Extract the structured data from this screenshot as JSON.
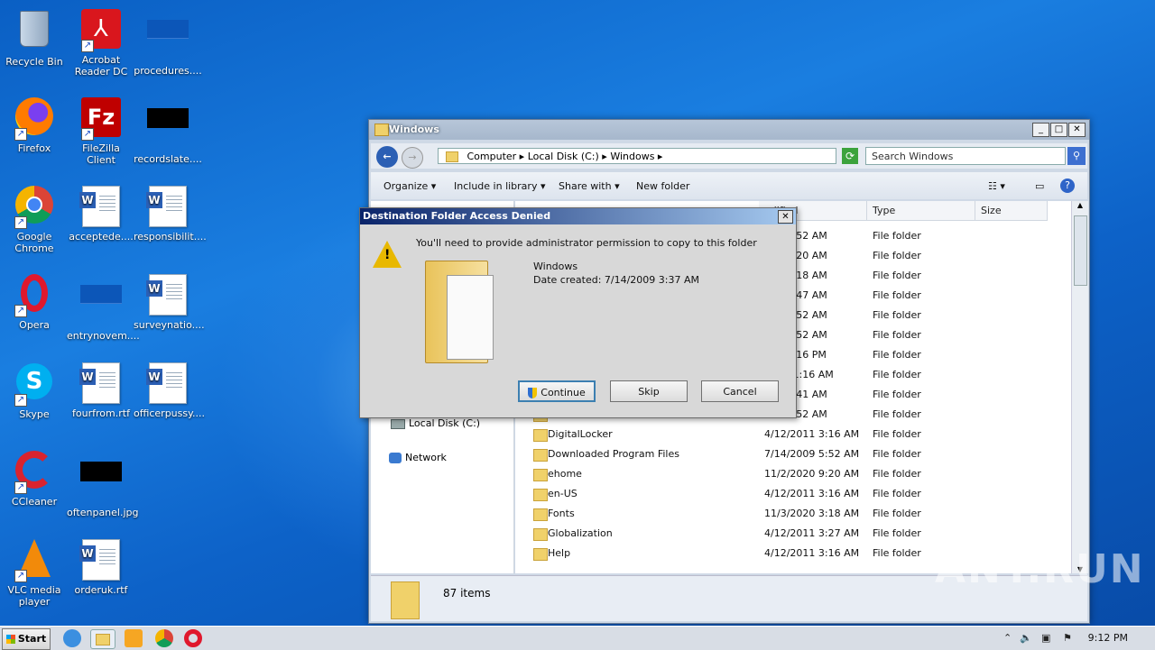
{
  "desktop": {
    "icons": [
      {
        "label": "Recycle Bin"
      },
      {
        "label": "Acrobat Reader DC"
      },
      {
        "label": "procedures...."
      },
      {
        "label": "Firefox"
      },
      {
        "label": "FileZilla Client"
      },
      {
        "label": "recordslate...."
      },
      {
        "label": "Google Chrome"
      },
      {
        "label": "acceptede...."
      },
      {
        "label": "responsibilit...."
      },
      {
        "label": "Opera"
      },
      {
        "label": "entrynovem...."
      },
      {
        "label": "surveynatio...."
      },
      {
        "label": "Skype"
      },
      {
        "label": "fourfrom.rtf"
      },
      {
        "label": "officerpussy...."
      },
      {
        "label": "CCleaner"
      },
      {
        "label": "oftenpanel.jpg"
      },
      {
        "label": "VLC media player"
      },
      {
        "label": "orderuk.rtf"
      }
    ]
  },
  "explorer": {
    "title": "Windows",
    "breadcrumb": [
      "Computer",
      "Local Disk (C:)",
      "Windows"
    ],
    "search_placeholder": "Search Windows",
    "toolbar": {
      "organize": "Organize",
      "include": "Include in library",
      "share": "Share with",
      "new_folder": "New folder"
    },
    "columns": {
      "modified": "odified",
      "type": "Type",
      "size": "Size"
    },
    "rows": [
      {
        "name": "",
        "date": "009 5:52 AM",
        "type": "File folder"
      },
      {
        "name": "",
        "date": "020 9:20 AM",
        "type": "File folder"
      },
      {
        "name": "",
        "date": "020 3:18 AM",
        "type": "File folder"
      },
      {
        "name": "",
        "date": "020 7:47 AM",
        "type": "File folder"
      },
      {
        "name": "",
        "date": "009 5:52 AM",
        "type": "File folder"
      },
      {
        "name": "",
        "date": "009 5:52 AM",
        "type": "File folder"
      },
      {
        "name": "",
        "date": "017 6:16 PM",
        "type": "File folder"
      },
      {
        "name": "",
        "date": "017 11:16 AM",
        "type": "File folder"
      },
      {
        "name": "",
        "date": "020 6:41 AM",
        "type": "File folder"
      },
      {
        "name": "",
        "date": "009 5:52 AM",
        "type": "File folder"
      },
      {
        "name": "DigitalLocker",
        "date": "4/12/2011 3:16 AM",
        "type": "File folder"
      },
      {
        "name": "Downloaded Program Files",
        "date": "7/14/2009 5:52 AM",
        "type": "File folder"
      },
      {
        "name": "ehome",
        "date": "11/2/2020 9:20 AM",
        "type": "File folder"
      },
      {
        "name": "en-US",
        "date": "4/12/2011 3:16 AM",
        "type": "File folder"
      },
      {
        "name": "Fonts",
        "date": "11/3/2020 3:18 AM",
        "type": "File folder"
      },
      {
        "name": "Globalization",
        "date": "4/12/2011 3:27 AM",
        "type": "File folder"
      },
      {
        "name": "Help",
        "date": "4/12/2011 3:16 AM",
        "type": "File folder"
      }
    ],
    "nav": {
      "local_disk": "Local Disk (C:)",
      "network": "Network"
    },
    "status": "87 items"
  },
  "dialog": {
    "title": "Destination Folder Access Denied",
    "message": "You'll need to provide administrator permission to copy to this folder",
    "folder_name": "Windows",
    "date_created": "Date created: 7/14/2009 3:37 AM",
    "continue": "Continue",
    "skip": "Skip",
    "cancel": "Cancel"
  },
  "taskbar": {
    "start": "Start",
    "clock": "9:12 PM"
  },
  "watermark": "ANY.RUN"
}
